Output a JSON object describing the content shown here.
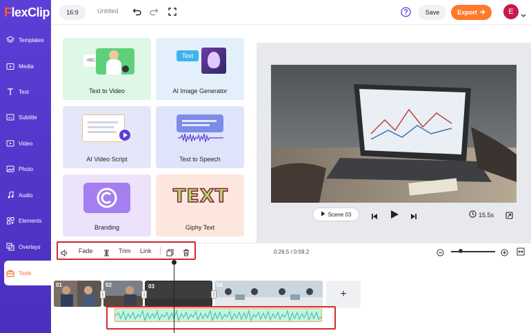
{
  "app": {
    "logo_prefix": "F",
    "logo_rest": "lexClip"
  },
  "sidebar": {
    "items": [
      {
        "label": "Templates",
        "icon": "layers-icon"
      },
      {
        "label": "Media",
        "icon": "folder-icon"
      },
      {
        "label": "Text",
        "icon": "text-icon"
      },
      {
        "label": "Subtitle",
        "icon": "subtitle-icon"
      },
      {
        "label": "Video",
        "icon": "video-icon"
      },
      {
        "label": "Photo",
        "icon": "photo-icon"
      },
      {
        "label": "Audio",
        "icon": "music-icon"
      },
      {
        "label": "Elements",
        "icon": "elements-icon"
      },
      {
        "label": "Overlays",
        "icon": "overlays-icon"
      },
      {
        "label": "Tools",
        "icon": "toolbox-icon"
      }
    ],
    "active": "Tools"
  },
  "topbar": {
    "ratio": "16:9",
    "title": "Untitled",
    "save_label": "Save",
    "export_label": "Export",
    "avatar_letter": "E"
  },
  "tools": {
    "cards": [
      {
        "label": "Text to Video",
        "bg": "#dff7e6"
      },
      {
        "label": "AI Image Generator",
        "bg": "#e3f0fb"
      },
      {
        "label": "AI Video Script",
        "bg": "#e6e6fb"
      },
      {
        "label": "Text to Speech",
        "bg": "#dfe4fa"
      },
      {
        "label": "Branding",
        "bg": "#ece2fb"
      },
      {
        "label": "Giphy Text",
        "bg": "#fde6de"
      }
    ],
    "card_texts": {
      "abc": "ABC",
      "text_badge": "Text",
      "giphy": "TEXT"
    }
  },
  "preview": {
    "scene_label": "Scene 03",
    "duration": "15.5s"
  },
  "timeline": {
    "tools": [
      "Fade",
      "Trim",
      "Link"
    ],
    "time_display": "0:26.5 / 0:59.2",
    "clips": [
      "01",
      "02",
      "03",
      "04"
    ],
    "add_label": "+"
  },
  "colors": {
    "accent": "#ff7a2d",
    "sidebar": "#5b3fd6",
    "highlight": "#d42a2a",
    "audio": "#3ccf9a"
  }
}
